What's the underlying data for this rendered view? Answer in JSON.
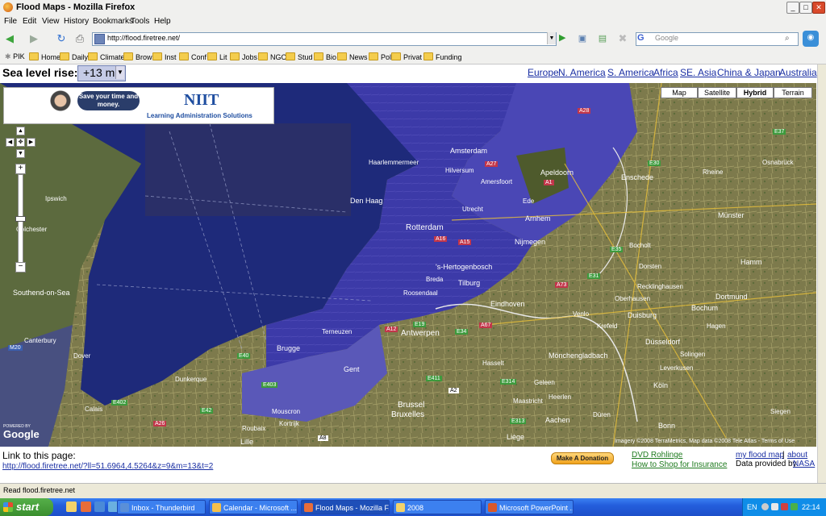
{
  "window": {
    "title": "Flood Maps - Mozilla Firefox",
    "min": "_",
    "max": "□",
    "close": "✕"
  },
  "menu": [
    "File",
    "Edit",
    "View",
    "History",
    "Bookmarks",
    "Tools",
    "Help"
  ],
  "nav": {
    "url": "http://flood.firetree.net/",
    "search_placeholder": "Google",
    "search_engine": "G"
  },
  "bookmarks": [
    "PIK",
    "Home",
    "Daily",
    "Climate",
    "Brow",
    "Inst",
    "Conf",
    "Lit",
    "Jobs",
    "NGO",
    "Stud",
    "Bio",
    "News",
    "Pol",
    "Privat",
    "Funding"
  ],
  "page": {
    "sea_label": "Sea level rise:",
    "sea_value": "+13 m",
    "regions": [
      "Europe",
      "N. America",
      "S. America",
      "Africa",
      "SE. Asia",
      "China & Japan",
      "Australia"
    ],
    "ad": {
      "bubble": "Save your time and money.",
      "logo": "NIIT",
      "tagline": "Learning Administration Solutions"
    },
    "map_types": [
      "Map",
      "Satellite",
      "Hybrid",
      "Terrain"
    ],
    "map_type_selected": "Hybrid",
    "google": {
      "powered": "POWERED BY",
      "logo": "Google"
    },
    "copyright": "Imagery ©2008 TerraMetrics, Map data ©2008 Tele Atlas - Terms of Use",
    "map_labels": {
      "cities": [
        "Amsterdam",
        "Haarlemmermeer",
        "Hilversum",
        "Amersfoort",
        "Apeldoorn",
        "Den Haag",
        "Rotterdam",
        "Arnhem",
        "Nijmegen",
        "Ede",
        "Enschede",
        "Osnabrück",
        "Rheine",
        "Münster",
        "Utrecht",
        "'s-Hertogenbosch",
        "Breda",
        "Tilburg",
        "Eindhoven",
        "Bocholt",
        "Dorsten",
        "Recklinghausen",
        "Hamm",
        "Dortmund",
        "Bochum",
        "Oberhausen",
        "Duisburg",
        "Krefeld",
        "Düsseldorf",
        "Hagen",
        "Mönchengladbach",
        "Solingen",
        "Leverkusen",
        "Köln",
        "Venlo",
        "Antwerpen",
        "Gent",
        "Brugge",
        "Brussel",
        "Bruxelles",
        "Aachen",
        "Maastricht",
        "Liège",
        "Lille",
        "Kortrijk",
        "Bonn",
        "Siegen",
        "Ipswich",
        "Southend-on-Sea",
        "Canterbury",
        "Dover",
        "Colchester",
        "Calais",
        "Dunkerque",
        "Roosendaal",
        "Terneuzen",
        "Hasselt",
        "Geleen",
        "Heerlen",
        "Mouscron",
        "Roubaix",
        "Düren"
      ],
      "roads": [
        "A1",
        "A2",
        "A12",
        "A15",
        "A16",
        "A27",
        "A28",
        "A67",
        "A73",
        "E19",
        "E30",
        "E31",
        "E34",
        "E35",
        "E37",
        "E40",
        "E42",
        "E313",
        "E314",
        "E402",
        "E403",
        "E411",
        "M20",
        "A26",
        "A8"
      ]
    },
    "link_label": "Link to this page:",
    "link_url": "http://flood.firetree.net/?ll=51.6964,4.5264&z=9&m=13&t=2",
    "donate": "Make A Donation",
    "dvd": "DVD Rohlinge",
    "shop": "How to Shop for Insurance",
    "my_flood_map": "my flood map",
    "separator": "|",
    "about": "about",
    "data_provided": "Data provided by",
    "nasa": "NASA"
  },
  "status": "Read flood.firetree.net",
  "taskbar": {
    "start": "start",
    "tasks": [
      "Inbox - Thunderbird",
      "Calendar - Microsoft ...",
      "Flood Maps - Mozilla F...",
      "2008",
      "Microsoft PowerPoint ..."
    ],
    "active_task": 2,
    "lang": "EN",
    "clock": "22:14"
  },
  "colors": {
    "link": "#1a2fa3",
    "flood_blue": "#3a3fae",
    "sea": "#1e2a7a",
    "taskbar": "#245edc",
    "start": "#3a8e2e"
  }
}
